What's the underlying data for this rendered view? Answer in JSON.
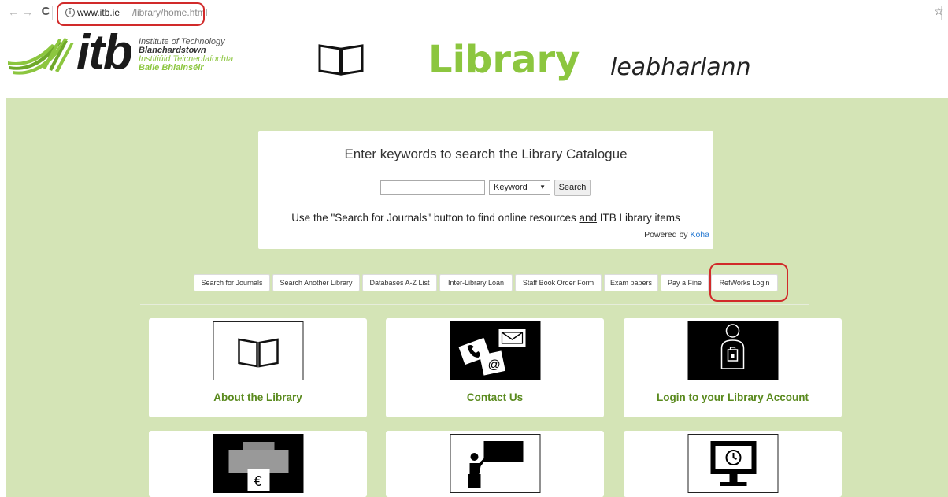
{
  "browser": {
    "url_host": "www.itb.ie",
    "url_path": "/library/home.html"
  },
  "header": {
    "logo_wordmark": "itb",
    "logo_lines": [
      "Institute of Technology",
      "Blanchardstown",
      "Institiúid Teicneolaíochta",
      "Baile Bhlainséir"
    ],
    "title": "Library",
    "title_irish": "leabharlann",
    "accent_color": "#8cc63f"
  },
  "search": {
    "heading": "Enter keywords to search the Library Catalogue",
    "input_value": "",
    "select_value": "Keyword",
    "button_label": "Search",
    "hint_before": "Use the \"Search for Journals\" button to find online resources ",
    "hint_underlined": "and",
    "hint_after": " ITB Library items",
    "powered_prefix": "Powered by ",
    "powered_link": "Koha"
  },
  "quick_links": [
    "Search for Journals",
    "Search Another Library",
    "Databases A-Z List",
    "Inter-Library Loan",
    "Staff Book Order Form",
    "Exam papers",
    "Pay a Fine",
    "RefWorks Login"
  ],
  "tiles": [
    {
      "label": "About the Library",
      "icon": "open-book-icon"
    },
    {
      "label": "Contact Us",
      "icon": "contact-icon"
    },
    {
      "label": "Login to your Library Account",
      "icon": "user-login-icon"
    },
    {
      "label": "",
      "icon": "printer-payment-icon"
    },
    {
      "label": "",
      "icon": "presenter-icon"
    },
    {
      "label": "",
      "icon": "monitor-clock-icon"
    }
  ],
  "colors": {
    "background_green": "#d4e4b6",
    "tile_label": "#5a8a1e",
    "highlight_red": "#d12a2a"
  }
}
